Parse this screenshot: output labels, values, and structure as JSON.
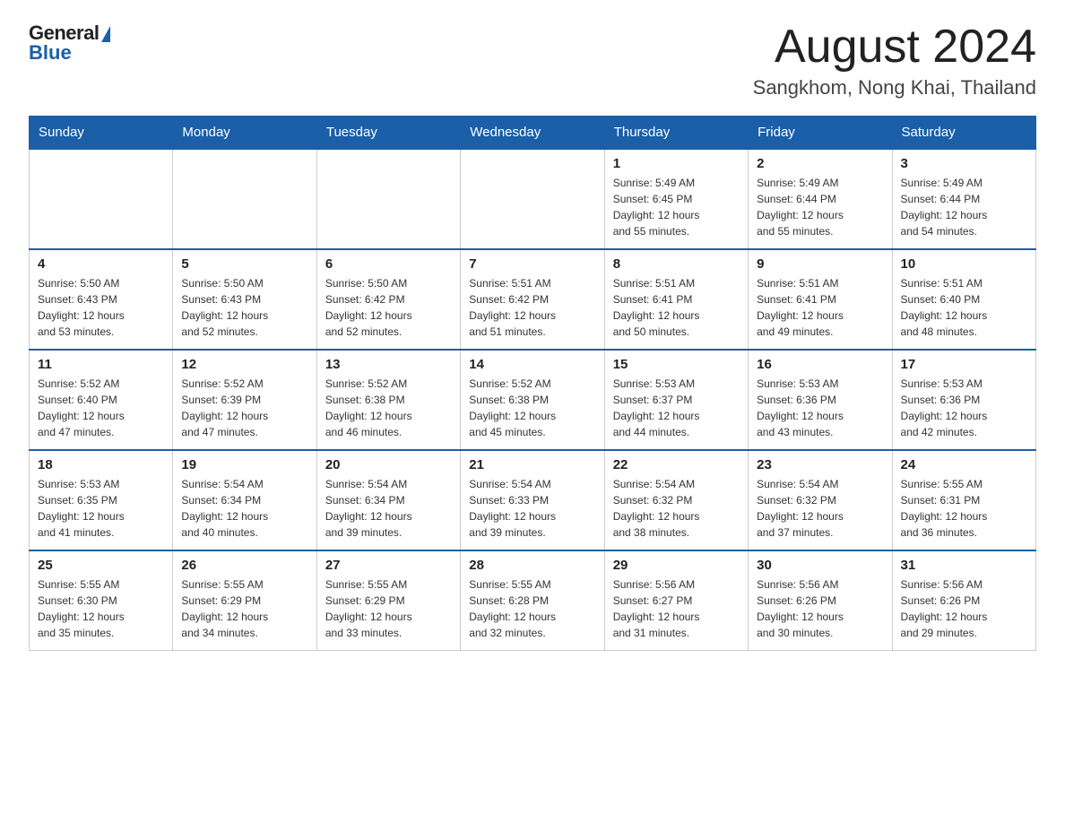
{
  "header": {
    "logo_general": "General",
    "logo_blue": "Blue",
    "month_title": "August 2024",
    "location": "Sangkhom, Nong Khai, Thailand"
  },
  "days_of_week": [
    "Sunday",
    "Monday",
    "Tuesday",
    "Wednesday",
    "Thursday",
    "Friday",
    "Saturday"
  ],
  "weeks": [
    [
      {
        "day": "",
        "info": ""
      },
      {
        "day": "",
        "info": ""
      },
      {
        "day": "",
        "info": ""
      },
      {
        "day": "",
        "info": ""
      },
      {
        "day": "1",
        "info": "Sunrise: 5:49 AM\nSunset: 6:45 PM\nDaylight: 12 hours\nand 55 minutes."
      },
      {
        "day": "2",
        "info": "Sunrise: 5:49 AM\nSunset: 6:44 PM\nDaylight: 12 hours\nand 55 minutes."
      },
      {
        "day": "3",
        "info": "Sunrise: 5:49 AM\nSunset: 6:44 PM\nDaylight: 12 hours\nand 54 minutes."
      }
    ],
    [
      {
        "day": "4",
        "info": "Sunrise: 5:50 AM\nSunset: 6:43 PM\nDaylight: 12 hours\nand 53 minutes."
      },
      {
        "day": "5",
        "info": "Sunrise: 5:50 AM\nSunset: 6:43 PM\nDaylight: 12 hours\nand 52 minutes."
      },
      {
        "day": "6",
        "info": "Sunrise: 5:50 AM\nSunset: 6:42 PM\nDaylight: 12 hours\nand 52 minutes."
      },
      {
        "day": "7",
        "info": "Sunrise: 5:51 AM\nSunset: 6:42 PM\nDaylight: 12 hours\nand 51 minutes."
      },
      {
        "day": "8",
        "info": "Sunrise: 5:51 AM\nSunset: 6:41 PM\nDaylight: 12 hours\nand 50 minutes."
      },
      {
        "day": "9",
        "info": "Sunrise: 5:51 AM\nSunset: 6:41 PM\nDaylight: 12 hours\nand 49 minutes."
      },
      {
        "day": "10",
        "info": "Sunrise: 5:51 AM\nSunset: 6:40 PM\nDaylight: 12 hours\nand 48 minutes."
      }
    ],
    [
      {
        "day": "11",
        "info": "Sunrise: 5:52 AM\nSunset: 6:40 PM\nDaylight: 12 hours\nand 47 minutes."
      },
      {
        "day": "12",
        "info": "Sunrise: 5:52 AM\nSunset: 6:39 PM\nDaylight: 12 hours\nand 47 minutes."
      },
      {
        "day": "13",
        "info": "Sunrise: 5:52 AM\nSunset: 6:38 PM\nDaylight: 12 hours\nand 46 minutes."
      },
      {
        "day": "14",
        "info": "Sunrise: 5:52 AM\nSunset: 6:38 PM\nDaylight: 12 hours\nand 45 minutes."
      },
      {
        "day": "15",
        "info": "Sunrise: 5:53 AM\nSunset: 6:37 PM\nDaylight: 12 hours\nand 44 minutes."
      },
      {
        "day": "16",
        "info": "Sunrise: 5:53 AM\nSunset: 6:36 PM\nDaylight: 12 hours\nand 43 minutes."
      },
      {
        "day": "17",
        "info": "Sunrise: 5:53 AM\nSunset: 6:36 PM\nDaylight: 12 hours\nand 42 minutes."
      }
    ],
    [
      {
        "day": "18",
        "info": "Sunrise: 5:53 AM\nSunset: 6:35 PM\nDaylight: 12 hours\nand 41 minutes."
      },
      {
        "day": "19",
        "info": "Sunrise: 5:54 AM\nSunset: 6:34 PM\nDaylight: 12 hours\nand 40 minutes."
      },
      {
        "day": "20",
        "info": "Sunrise: 5:54 AM\nSunset: 6:34 PM\nDaylight: 12 hours\nand 39 minutes."
      },
      {
        "day": "21",
        "info": "Sunrise: 5:54 AM\nSunset: 6:33 PM\nDaylight: 12 hours\nand 39 minutes."
      },
      {
        "day": "22",
        "info": "Sunrise: 5:54 AM\nSunset: 6:32 PM\nDaylight: 12 hours\nand 38 minutes."
      },
      {
        "day": "23",
        "info": "Sunrise: 5:54 AM\nSunset: 6:32 PM\nDaylight: 12 hours\nand 37 minutes."
      },
      {
        "day": "24",
        "info": "Sunrise: 5:55 AM\nSunset: 6:31 PM\nDaylight: 12 hours\nand 36 minutes."
      }
    ],
    [
      {
        "day": "25",
        "info": "Sunrise: 5:55 AM\nSunset: 6:30 PM\nDaylight: 12 hours\nand 35 minutes."
      },
      {
        "day": "26",
        "info": "Sunrise: 5:55 AM\nSunset: 6:29 PM\nDaylight: 12 hours\nand 34 minutes."
      },
      {
        "day": "27",
        "info": "Sunrise: 5:55 AM\nSunset: 6:29 PM\nDaylight: 12 hours\nand 33 minutes."
      },
      {
        "day": "28",
        "info": "Sunrise: 5:55 AM\nSunset: 6:28 PM\nDaylight: 12 hours\nand 32 minutes."
      },
      {
        "day": "29",
        "info": "Sunrise: 5:56 AM\nSunset: 6:27 PM\nDaylight: 12 hours\nand 31 minutes."
      },
      {
        "day": "30",
        "info": "Sunrise: 5:56 AM\nSunset: 6:26 PM\nDaylight: 12 hours\nand 30 minutes."
      },
      {
        "day": "31",
        "info": "Sunrise: 5:56 AM\nSunset: 6:26 PM\nDaylight: 12 hours\nand 29 minutes."
      }
    ]
  ]
}
